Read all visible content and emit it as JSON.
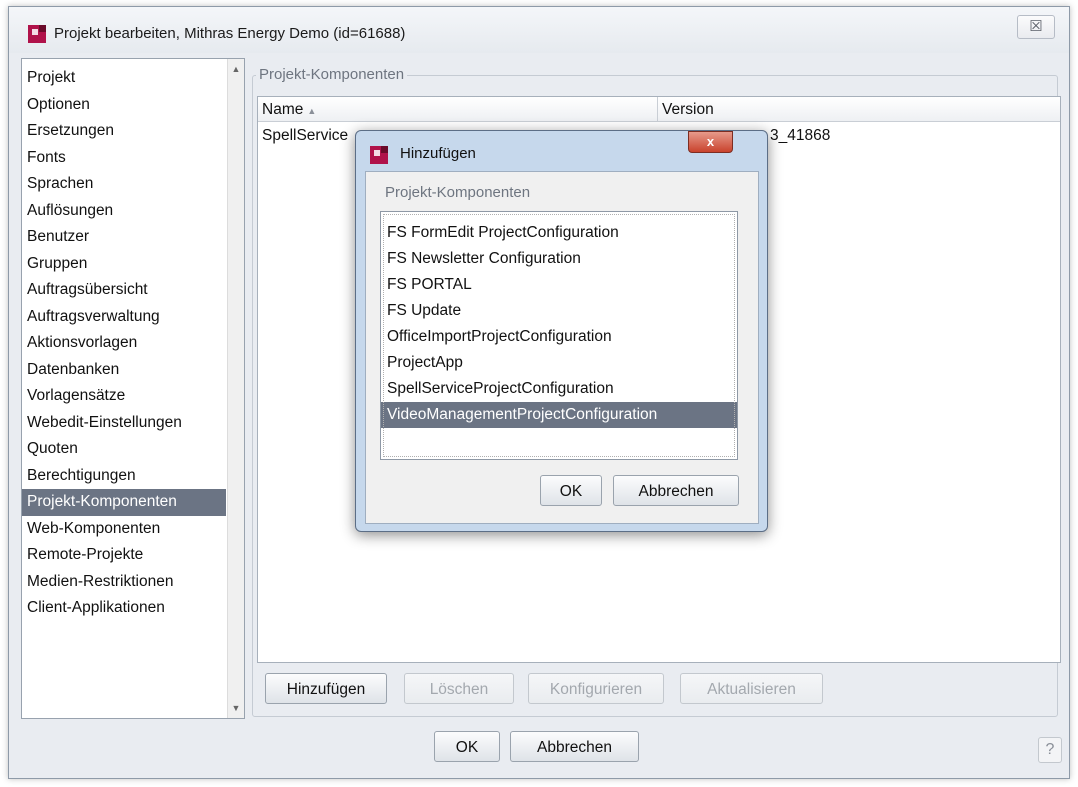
{
  "window": {
    "title": "Projekt bearbeiten, Mithras Energy Demo (id=61688)",
    "close_glyph": "☒"
  },
  "nav": {
    "items": [
      "Projekt",
      "Optionen",
      "Ersetzungen",
      "Fonts",
      "Sprachen",
      "Auflösungen",
      "Benutzer",
      "Gruppen",
      "Auftragsübersicht",
      "Auftragsverwaltung",
      "Aktionsvorlagen",
      "Datenbanken",
      "Vorlagensätze",
      "Webedit-Einstellungen",
      "Quoten",
      "Berechtigungen",
      "Projekt-Komponenten",
      "Web-Komponenten",
      "Remote-Projekte",
      "Medien-Restriktionen",
      "Client-Applikationen"
    ],
    "selected": "Projekt-Komponenten"
  },
  "panel": {
    "group_label": "Projekt-Komponenten",
    "columns": {
      "name": "Name",
      "version": "Version"
    },
    "rows": [
      {
        "name": "SpellService",
        "version": "3_41868"
      }
    ]
  },
  "buttons": {
    "add": "Hinzufügen",
    "delete": "Löschen",
    "configure": "Konfigurieren",
    "update": "Aktualisieren",
    "ok": "OK",
    "cancel": "Abbrechen",
    "help": "?"
  },
  "dialog": {
    "title": "Hinzufügen",
    "close_glyph": "x",
    "group_label": "Projekt-Komponenten",
    "items": [
      "FS FormEdit ProjectConfiguration",
      "FS Newsletter Configuration",
      "FS PORTAL",
      "FS Update",
      "OfficeImportProjectConfiguration",
      "ProjectApp",
      "SpellServiceProjectConfiguration",
      "VideoManagementProjectConfiguration"
    ],
    "selected": "VideoManagementProjectConfiguration",
    "ok": "OK",
    "cancel": "Abbrechen"
  },
  "colors": {
    "selection": "#6b7484",
    "brand_icon": "#b0124a",
    "dialog_frame": "#c6d8ec"
  }
}
